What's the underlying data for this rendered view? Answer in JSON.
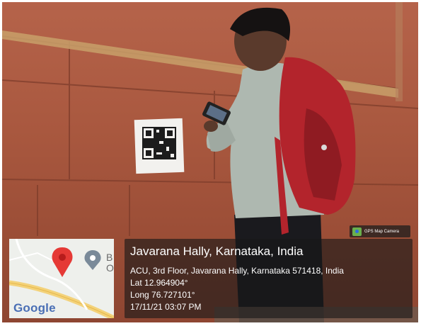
{
  "overlay": {
    "location_title": "Javarana Hally, Karnataka, India",
    "address": "ACU, 3rd Floor, Javarana Hally, Karnataka 571418, India",
    "latitude": "Lat 12.964904°",
    "longitude": "Long 76.727101°",
    "datetime": "17/11/21 03:07 PM",
    "badge_label": "GPS Map Camera"
  },
  "map": {
    "logo_text": "Google",
    "place_label_line1": "B",
    "place_label_line2": "O",
    "pin_color": "#e53935"
  },
  "colors": {
    "wall": "#a9583f",
    "backpack": "#b3242c",
    "shirt": "#aeb8b0",
    "panel": "#191919"
  }
}
